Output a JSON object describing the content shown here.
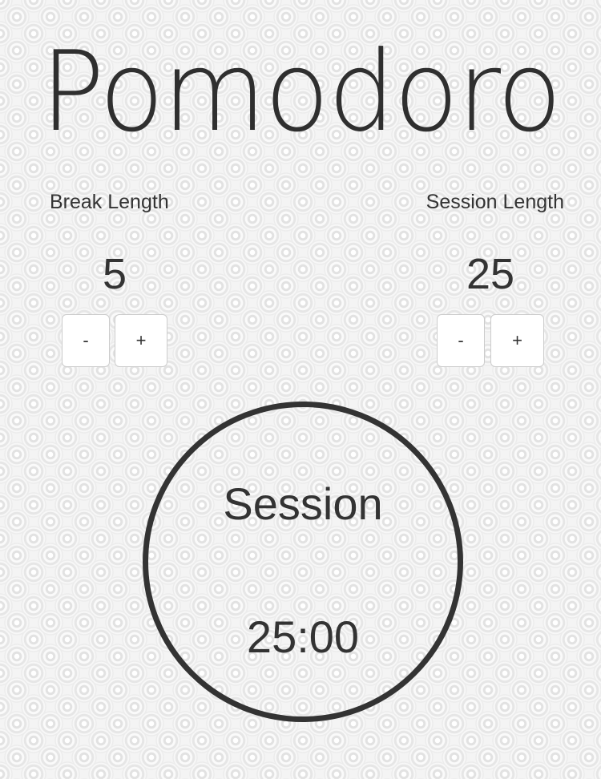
{
  "app": {
    "title": "Pomodoro"
  },
  "break": {
    "label": "Break Length",
    "value": "5",
    "decrement_label": "-",
    "increment_label": "+"
  },
  "session": {
    "label": "Session Length",
    "value": "25",
    "decrement_label": "-",
    "increment_label": "+"
  },
  "timer": {
    "mode_label": "Session",
    "time": "25:00"
  },
  "colors": {
    "text": "#333333",
    "button_bg": "#ffffff",
    "button_border": "#cccccc",
    "ring": "#333333"
  }
}
